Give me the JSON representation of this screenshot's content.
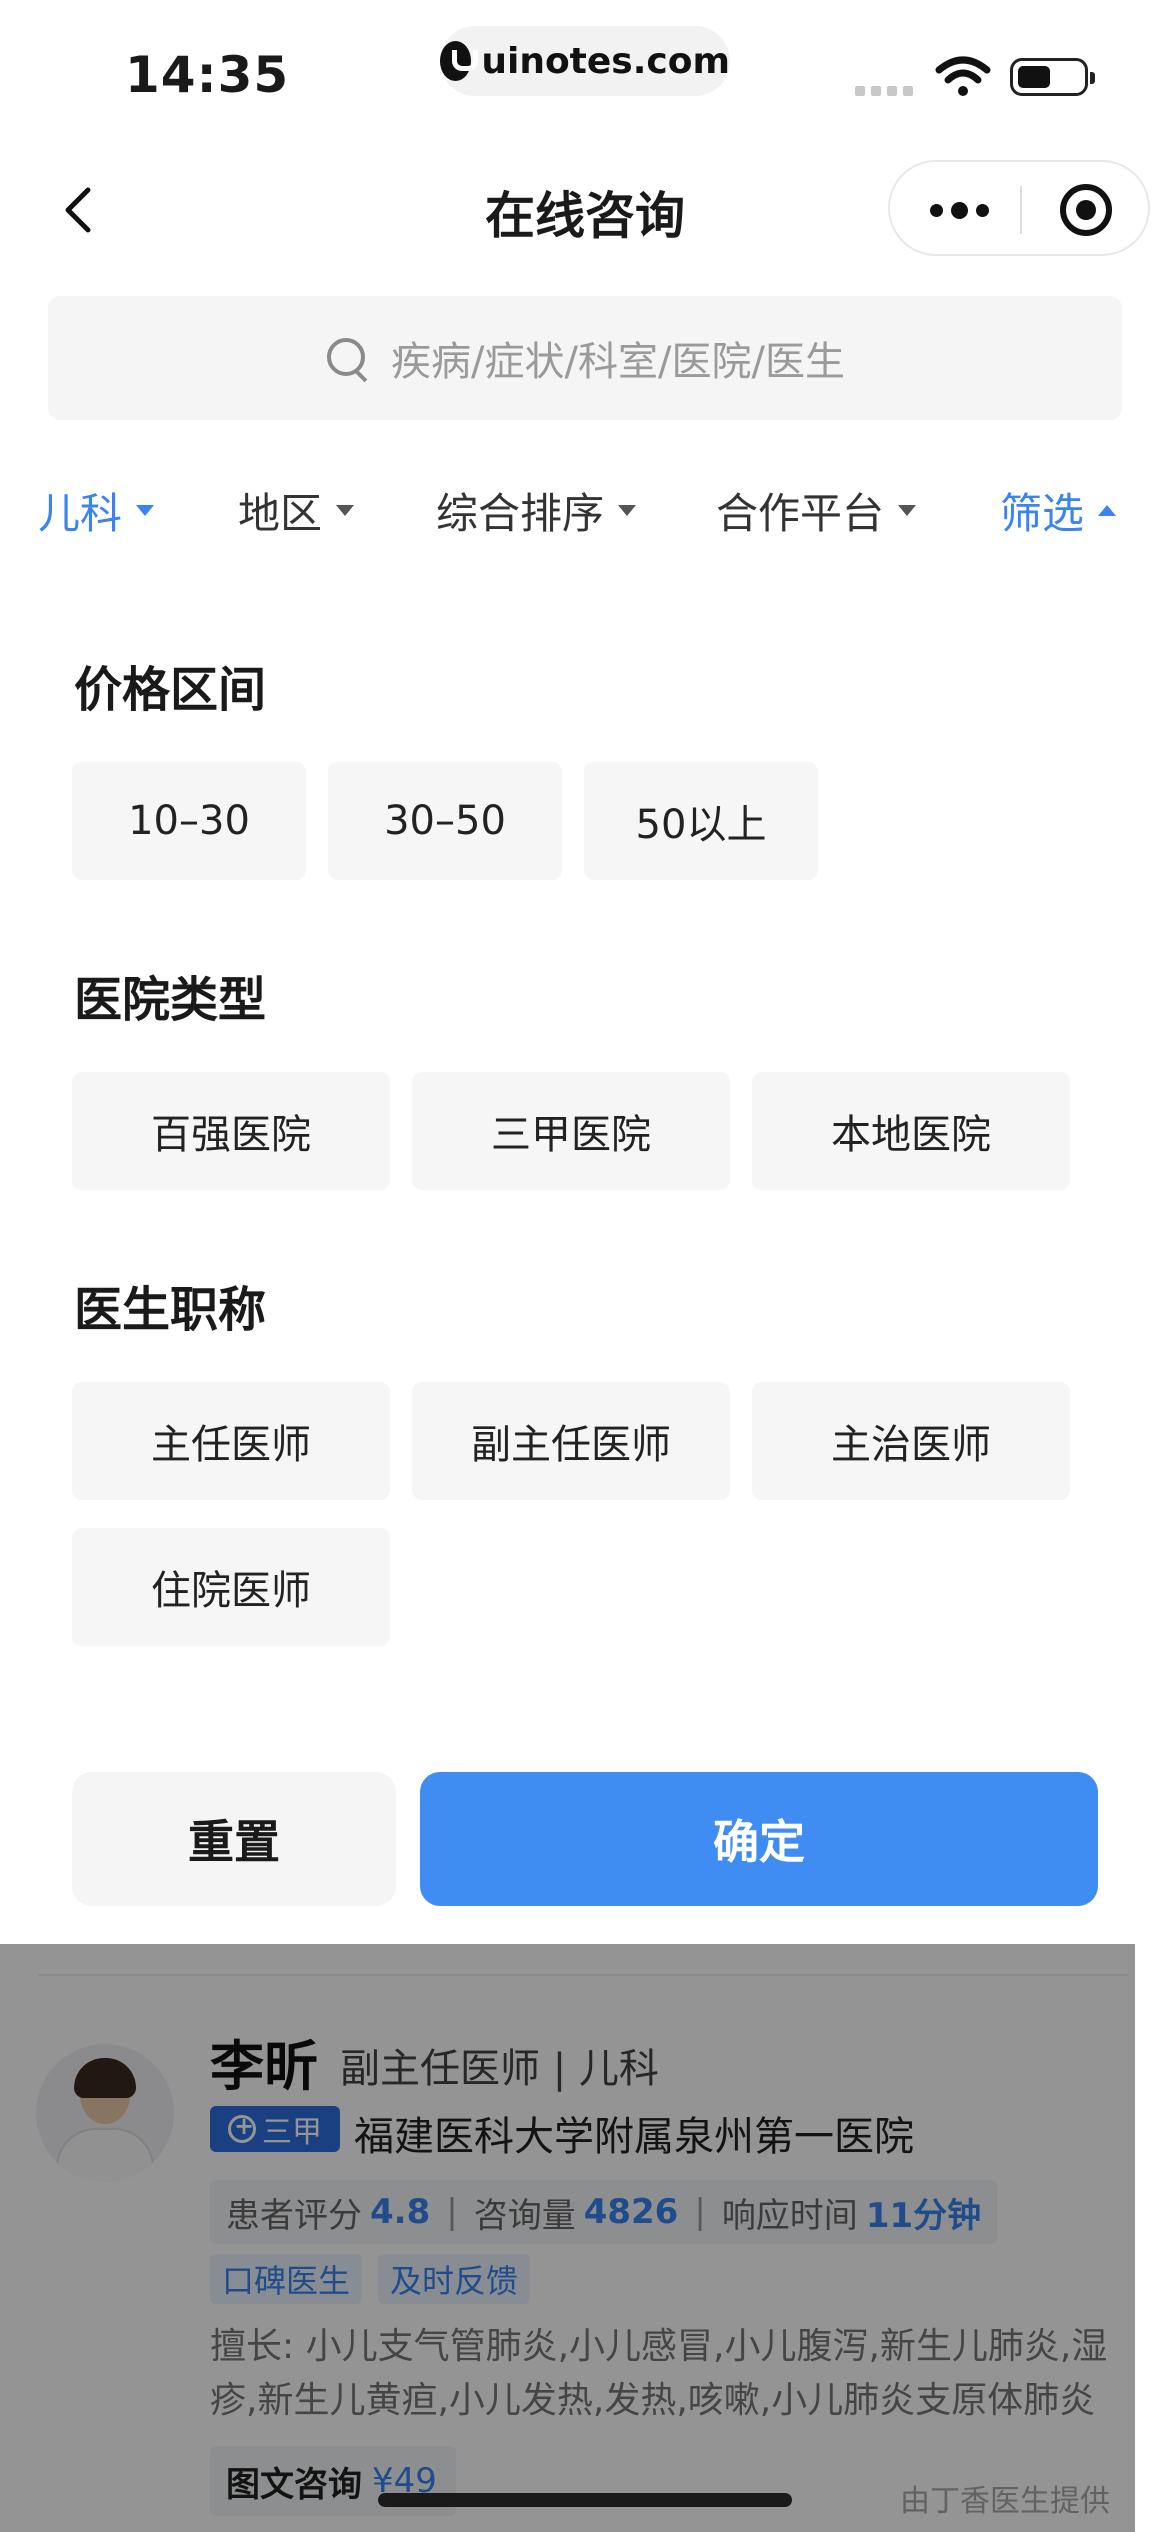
{
  "status_bar": {
    "time": "14:35",
    "url": "uinotes.com"
  },
  "nav": {
    "title": "在线咨询"
  },
  "search": {
    "placeholder": "疾病/症状/科室/医院/医生"
  },
  "filter_tabs": [
    {
      "label": "儿科",
      "active": true
    },
    {
      "label": "地区",
      "active": false
    },
    {
      "label": "综合排序",
      "active": false
    },
    {
      "label": "合作平台",
      "active": false
    },
    {
      "label": "筛选",
      "active": true
    }
  ],
  "filter_panel": {
    "price": {
      "title": "价格区间",
      "options": [
        "10–30",
        "30–50",
        "50以上"
      ]
    },
    "hospital_type": {
      "title": "医院类型",
      "options": [
        "百强医院",
        "三甲医院",
        "本地医院"
      ]
    },
    "doctor_title": {
      "title": "医生职称",
      "options": [
        "主任医师",
        "副主任医师",
        "主治医师",
        "住院医师"
      ]
    },
    "reset_label": "重置",
    "confirm_label": "确定"
  },
  "doctor_card": {
    "name": "李昕",
    "title_dept": "副主任医师 | 儿科",
    "badge": "三甲",
    "hospital": "福建医科大学附属泉州第一医院",
    "rating_label": "患者评分",
    "rating": "4.8",
    "consult_label": "咨询量",
    "consult_count": "4826",
    "response_label": "响应时间",
    "response_time": "11分钟",
    "tags": [
      "口碑医生",
      "及时反馈"
    ],
    "expertise": "擅长: 小儿支气管肺炎,小儿感冒,小儿腹泻,新生儿肺炎,湿疹,新生儿黄疸,小儿发热,发热,咳嗽,小儿肺炎支原体肺炎",
    "consult_type": "图文咨询",
    "price": "¥49",
    "provider": "由丁香医生提供"
  },
  "colors": {
    "accent": "#3a84f1",
    "confirm": "#3f8cf3",
    "chip_bg": "#f6f6f6"
  }
}
